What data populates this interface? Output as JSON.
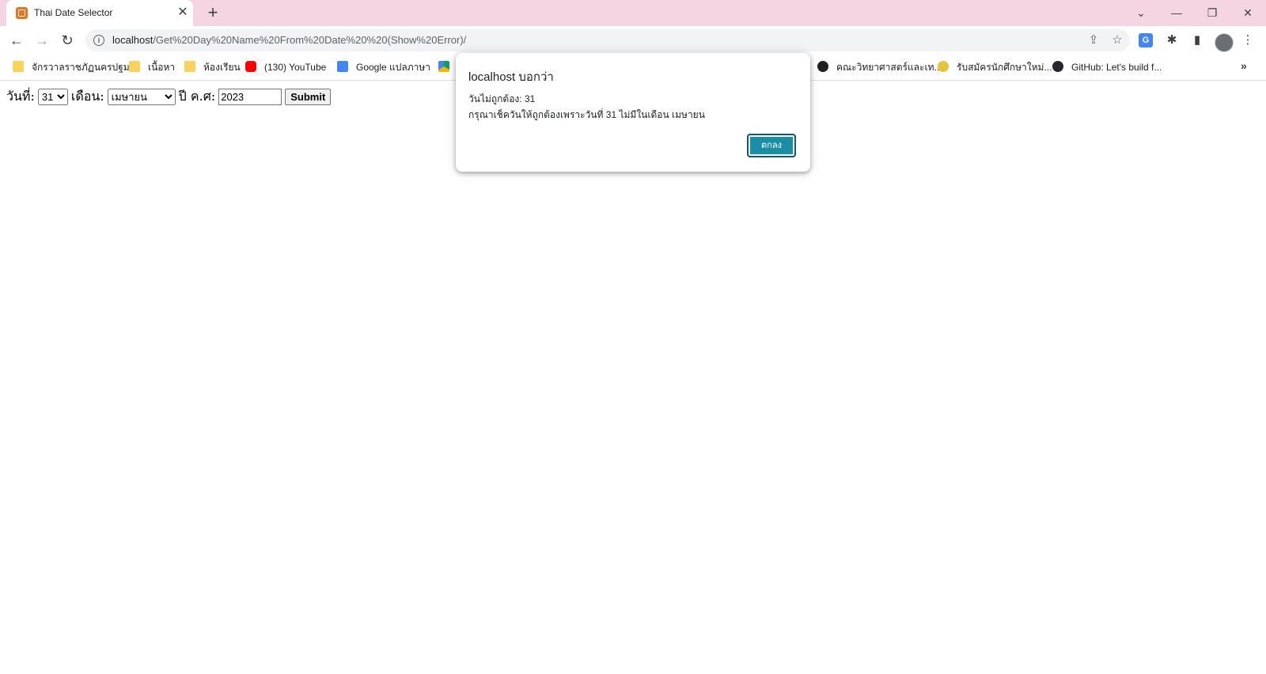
{
  "tab": {
    "title": "Thai Date Selector",
    "close_glyph": "✕"
  },
  "toolbar": {
    "url_host": "localhost",
    "url_path": "/Get%20Day%20Name%20From%20Date%20%20(Show%20Error)/"
  },
  "bookmarks": [
    {
      "label": "จักรวาลราชภัฏนครปฐม",
      "icon": "folder-icon"
    },
    {
      "label": "เนื้อหา",
      "icon": "folder-icon"
    },
    {
      "label": "ห้องเรียน",
      "icon": "folder-icon"
    },
    {
      "label": "(130) YouTube",
      "icon": "youtube-icon"
    },
    {
      "label": "Google แปลภาษา",
      "icon": "google-translate-icon"
    },
    {
      "label": "",
      "icon": "google-drive-icon"
    },
    {
      "label": "คณะวิทยาศาสตร์และเท...",
      "icon": "globe-icon"
    },
    {
      "label": "รับสมัครนักศึกษาใหม่...",
      "icon": "university-seal-icon"
    },
    {
      "label": "GitHub: Let's build f...",
      "icon": "github-icon"
    }
  ],
  "form": {
    "day_label": "วันที่:",
    "day_value": "31",
    "month_label": "เดือน:",
    "month_value": "เมษายน",
    "year_label": "ปี ค.ศ:",
    "year_value": "2023",
    "submit_label": "Submit"
  },
  "dialog": {
    "title": "localhost บอกว่า",
    "line1": "วันไม่ถูกต้อง: 31",
    "line2": "กรุณาเช็ควันให้ถูกต้องเพราะวันที่ 31 ไม่มีในเดือน เมษายน",
    "ok_label": "ตกลง"
  },
  "colors": {
    "tabstrip": "#f5d5e2",
    "dialog_ok": "#1a8ea6"
  }
}
